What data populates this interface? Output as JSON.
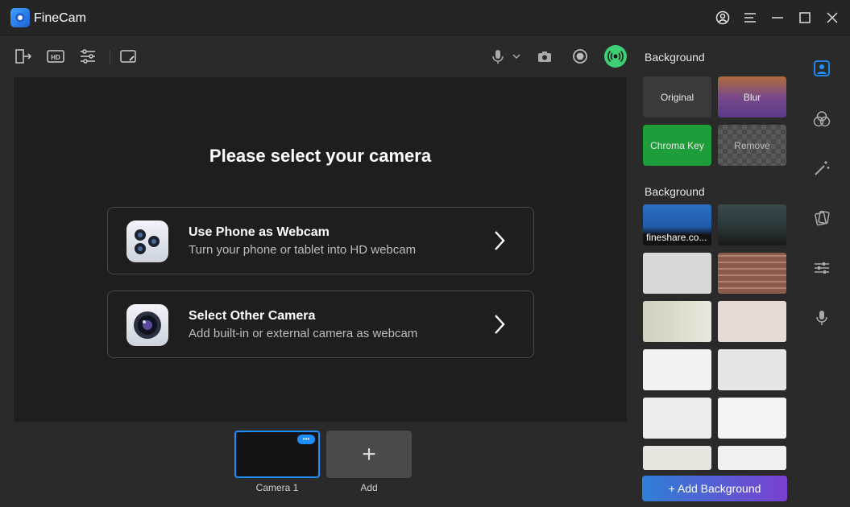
{
  "app": {
    "title": "FineCam"
  },
  "titlebar_icons": [
    "account-icon",
    "menu-icon",
    "minimize-icon",
    "maximize-icon",
    "close-icon"
  ],
  "toolbar_icons": [
    "exit-icon",
    "hd-icon",
    "adjust-icon",
    "sticker-icon",
    "mic-icon",
    "chevron-down-icon",
    "camera-icon",
    "record-icon",
    "live-icon"
  ],
  "main": {
    "headline": "Please select your camera",
    "options": [
      {
        "title": "Use Phone as Webcam",
        "subtitle": "Turn your phone or tablet into HD webcam"
      },
      {
        "title": "Select Other Camera",
        "subtitle": "Add built-in or external camera as webcam"
      }
    ]
  },
  "cameras": {
    "items": [
      {
        "label": "Camera 1"
      }
    ],
    "add_label": "Add",
    "add_symbol": "+",
    "more_symbol": "•••"
  },
  "panel": {
    "section1_title": "Background",
    "presets": [
      "Original",
      "Blur",
      "Chroma Key",
      "Remove"
    ],
    "section2_title": "Background",
    "first_thumb_label": "fineshare.co...",
    "add_button": "+ Add Background"
  },
  "side_icons": [
    "person-icon",
    "filters-icon",
    "magic-wand-icon",
    "stickers-icon",
    "sliders-icon",
    "microphone-icon"
  ],
  "colors": {
    "accent": "#1f8fff",
    "live": "#3ecf75",
    "chroma": "#1e9e3a"
  }
}
